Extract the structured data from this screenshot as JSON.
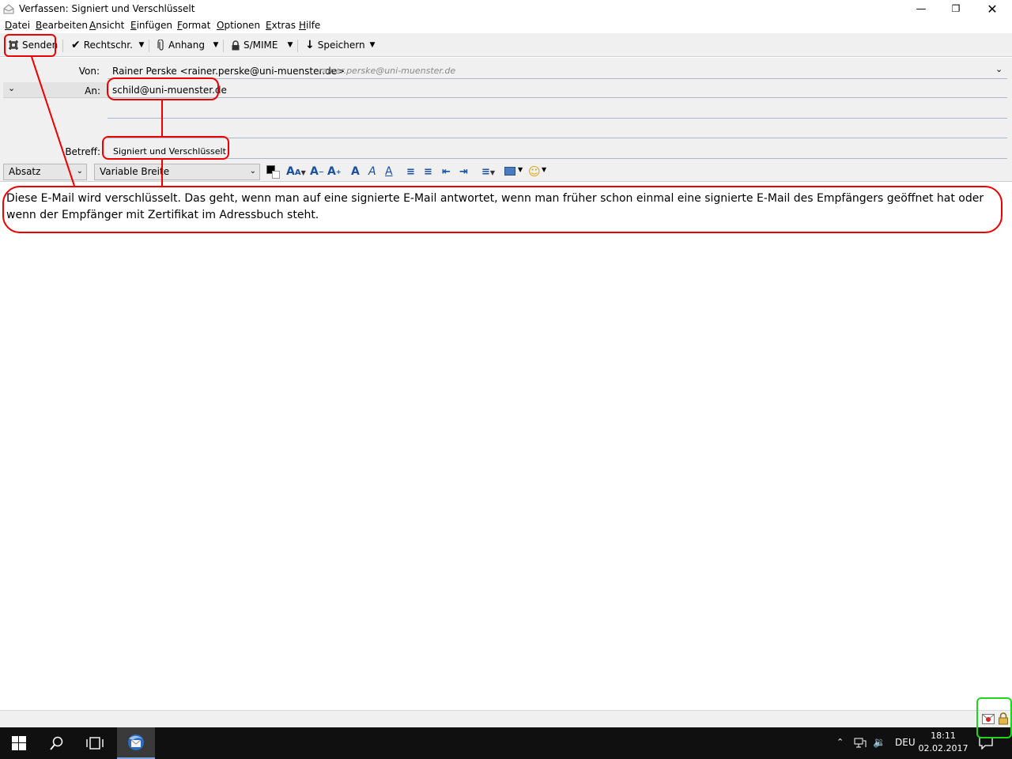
{
  "window": {
    "title": "Verfassen: Signiert und Verschlüsselt"
  },
  "menu": [
    {
      "label": "Datei",
      "accel": "D",
      "rest": "atei"
    },
    {
      "label": "Bearbeiten",
      "accel": "B",
      "rest": "earbeiten"
    },
    {
      "label": "Ansicht",
      "accel": "A",
      "rest": "nsicht"
    },
    {
      "label": "Einfügen",
      "accel": "E",
      "rest": "infügen"
    },
    {
      "label": "Format",
      "accel": "F",
      "rest": "ormat"
    },
    {
      "label": "Optionen",
      "accel": "O",
      "rest": "ptionen"
    },
    {
      "label": "Extras",
      "accel": "E",
      "rest": "xtras"
    },
    {
      "label": "Hilfe",
      "accel": "H",
      "rest": "ilfe"
    }
  ],
  "toolbar": {
    "send": "Senden",
    "spell": "Rechtschr.",
    "attach": "Anhang",
    "smime": "S/MIME",
    "save": "Speichern"
  },
  "headers": {
    "from_label": "Von:",
    "from_value": "Rainer Perske <rainer.perske@uni-muenster.de>",
    "from_hint": "rainer.perske@uni-muenster.de",
    "to_label": "An:",
    "to_value": "schild@uni-muenster.de",
    "subject_label": "Betreff:",
    "subject_value": "Signiert und Verschlüsselt"
  },
  "format": {
    "paragraph": "Absatz",
    "font": "Variable Breite"
  },
  "body": {
    "text": "Diese E-Mail wird verschlüsselt. Das geht, wenn man auf eine signierte E-Mail antwortet, wenn man früher schon einmal eine signierte E-Mail des Empfängers geöffnet hat oder wenn der Empfänger mit Zertifikat im Adressbuch steht."
  },
  "taskbar": {
    "language": "DEU",
    "time": "18:11",
    "date": "02.02.2017"
  },
  "colors": {
    "annotation_red": "#e00000",
    "annotation_green": "#1dd61d"
  }
}
